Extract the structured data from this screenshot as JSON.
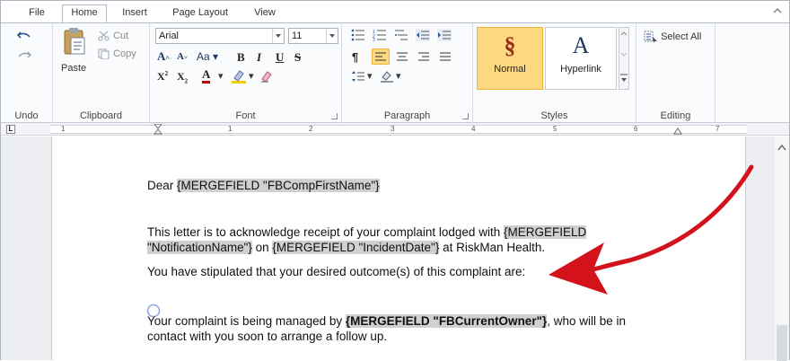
{
  "tabs": [
    "File",
    "Home",
    "Insert",
    "Page Layout",
    "View"
  ],
  "ribbon": {
    "undo": {
      "label": "Undo"
    },
    "clipboard": {
      "label": "Clipboard",
      "paste": "Paste",
      "cut": "Cut",
      "copy": "Copy"
    },
    "font": {
      "label": "Font",
      "family": "Arial",
      "size": "11",
      "bold": "B",
      "italic": "I",
      "underline": "U",
      "strike": "S"
    },
    "paragraph": {
      "label": "Paragraph"
    },
    "styles": {
      "label": "Styles",
      "items": [
        {
          "glyph": "§",
          "name": "Normal"
        },
        {
          "glyph": "A",
          "name": "Hyperlink"
        }
      ]
    },
    "editing": {
      "label": "Editing",
      "select_all": "Select All"
    }
  },
  "ruler": {
    "numbers": [
      "1",
      "1",
      "2",
      "3",
      "4",
      "5",
      "6",
      "7"
    ]
  },
  "document": {
    "salutation": "Dear ",
    "salutation_field": "{MERGEFIELD \"FBCompFirstName\"}",
    "p1_a": "This letter is to acknowledge receipt of your complaint lodged with ",
    "p1_field1a": "{MERGEFIELD",
    "p1_field1b": "\"NotificationName\"}",
    "p1_b": " on ",
    "p1_field2": "{MERGEFIELD \"IncidentDate\"}",
    "p1_c": " at RiskMan Health.",
    "p2": "You have stipulated that your desired outcome(s) of this complaint are:",
    "p3_a": "Your complaint is being managed by ",
    "p3_field": "{MERGEFIELD \"FBCurrentOwner\"}",
    "p3_b": ", who will be in",
    "p3_c": "contact with you soon to arrange a follow up."
  },
  "colors": {
    "arrow": "#d4121c",
    "selected_style": "#fcd97e",
    "merge_field_bg": "#d0d0d0"
  }
}
